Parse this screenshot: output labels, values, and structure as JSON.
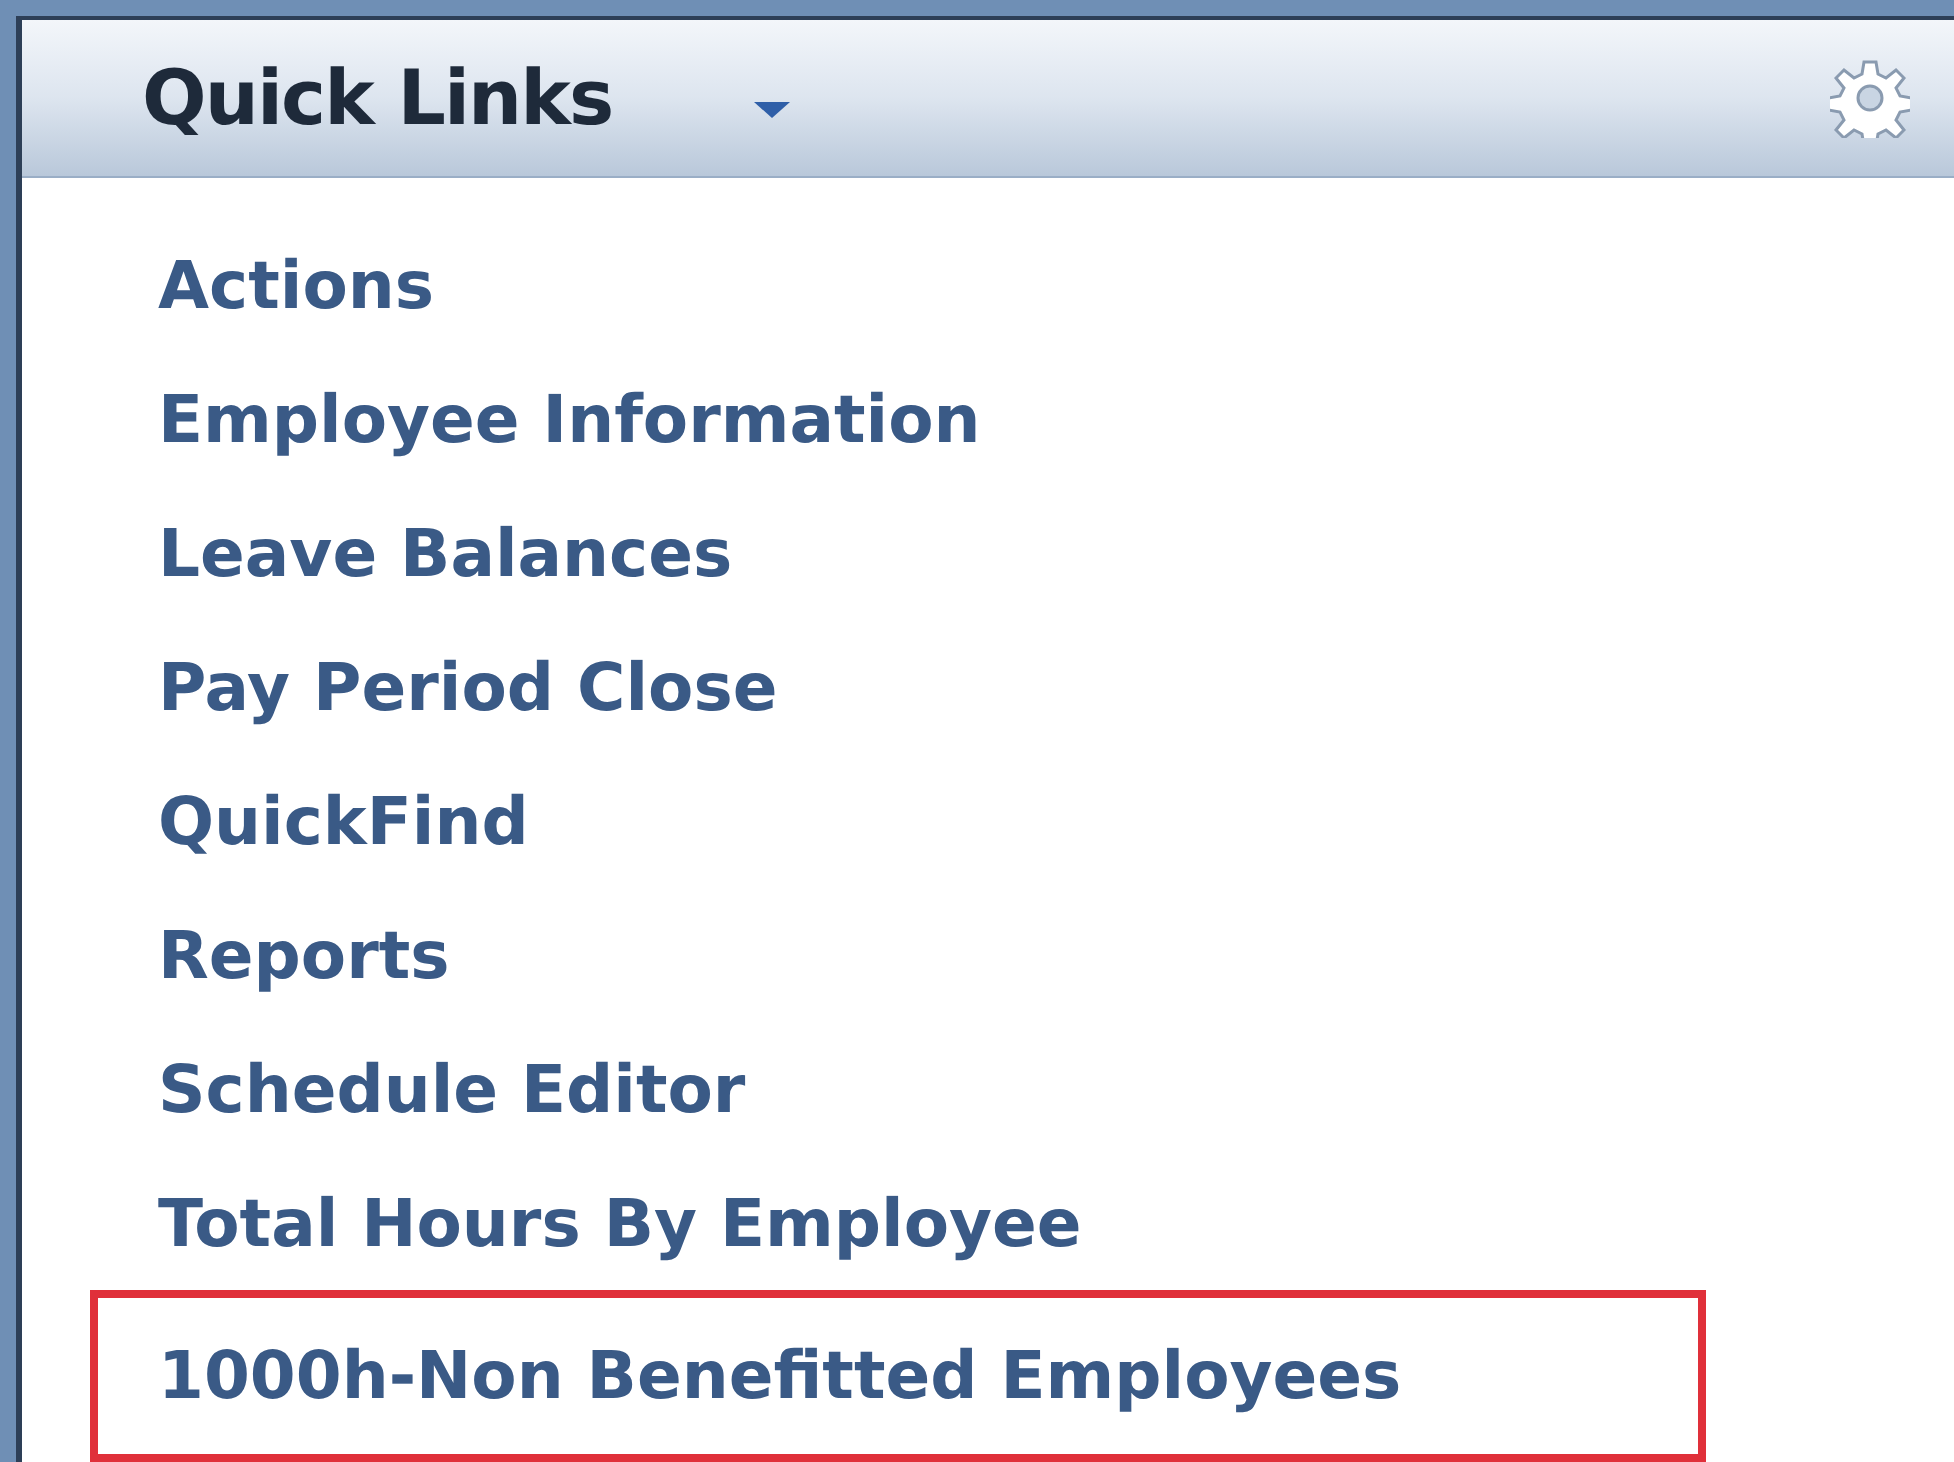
{
  "panel": {
    "title": "Quick Links"
  },
  "links": [
    {
      "label": "Actions",
      "highlighted": false
    },
    {
      "label": "Employee Information",
      "highlighted": false
    },
    {
      "label": "Leave Balances",
      "highlighted": false
    },
    {
      "label": "Pay Period Close",
      "highlighted": false
    },
    {
      "label": "QuickFind",
      "highlighted": false
    },
    {
      "label": "Reports",
      "highlighted": false
    },
    {
      "label": "Schedule Editor",
      "highlighted": false
    },
    {
      "label": "Total Hours By Employee",
      "highlighted": false
    },
    {
      "label": "1000h-Non Benefitted Employees",
      "highlighted": true
    }
  ]
}
